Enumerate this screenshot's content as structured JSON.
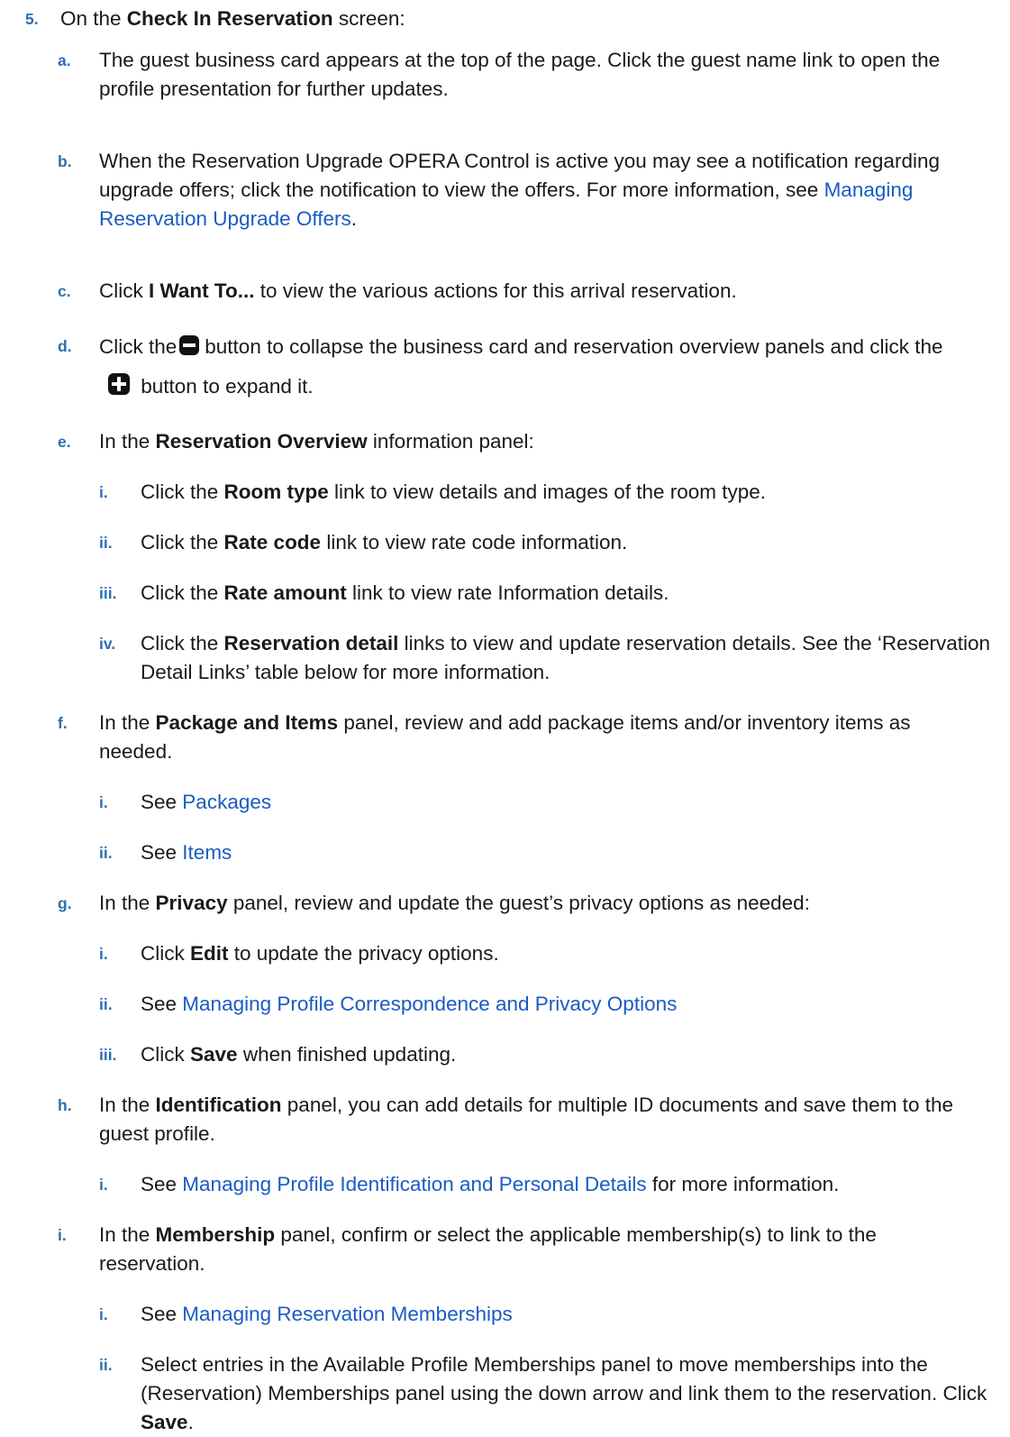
{
  "step5": {
    "num": "5.",
    "pre": "On the ",
    "bold": "Check In Reservation",
    "post": " screen:"
  },
  "a": {
    "num": "a.",
    "text": "The guest business card appears at the top of the page. Click the guest name link to open the profile presentation for further updates."
  },
  "b": {
    "num": "b.",
    "text": "When the Reservation Upgrade OPERA Control is active you may see a notification regarding upgrade offers; click the notification to view the offers. For more information, see ",
    "link": "Managing Reservation Upgrade Offers",
    "post": "."
  },
  "c": {
    "num": "c.",
    "pre": "Click ",
    "bold": "I Want To...",
    "post": " to view the various actions for this arrival reservation."
  },
  "d": {
    "num": "d.",
    "pre": "Click the",
    "mid": "button to collapse the business card and reservation overview panels and click the",
    "post": "button to expand it.",
    "collapse_icon": "collapse-minus-icon",
    "expand_icon": "expand-plus-icon"
  },
  "e": {
    "num": "e.",
    "pre": "In the ",
    "bold": "Reservation Overview",
    "post": " information panel:"
  },
  "e_i": {
    "num": "i.",
    "pre": "Click the ",
    "bold": "Room type",
    "post": " link to view details and images of the room type."
  },
  "e_ii": {
    "num": "ii.",
    "pre": "Click the ",
    "bold": "Rate code",
    "post": " link to view rate code information."
  },
  "e_iii": {
    "num": "iii.",
    "pre": "Click the ",
    "bold": "Rate amount",
    "post": " link to view rate Information details."
  },
  "e_iv": {
    "num": "iv.",
    "pre": "Click the ",
    "bold": "Reservation detail",
    "post": " links to view and update reservation details. See the ‘Reservation Detail Links’ table below for more information."
  },
  "f": {
    "num": "f.",
    "pre": "In the ",
    "bold": "Package and Items",
    "post": " panel, review and add package items and/or inventory items as needed."
  },
  "f_i": {
    "num": "i.",
    "pre": "See ",
    "link": "Packages"
  },
  "f_ii": {
    "num": "ii.",
    "pre": "See ",
    "link": "Items"
  },
  "g": {
    "num": "g.",
    "pre": "In the ",
    "bold": "Privacy",
    "post": " panel, review and update the guest’s privacy options as needed:"
  },
  "g_i": {
    "num": "i.",
    "pre": "Click ",
    "bold": "Edit",
    "post": " to update the privacy options."
  },
  "g_ii": {
    "num": "ii.",
    "pre": "See ",
    "link": "Managing Profile Correspondence and Privacy Options"
  },
  "g_iii": {
    "num": "iii.",
    "pre": "Click ",
    "bold": "Save",
    "post": " when finished updating."
  },
  "h": {
    "num": "h.",
    "pre": "In the ",
    "bold": "Identification",
    "post": " panel, you can add details for multiple ID documents and save them to the guest profile."
  },
  "h_i": {
    "num": "i.",
    "pre": "See ",
    "link": "Managing Profile Identification and Personal Details",
    "post": " for more information."
  },
  "i": {
    "num": "i.",
    "pre": "In the ",
    "bold": "Membership",
    "post": " panel, confirm or select the applicable membership(s) to link to the reservation."
  },
  "i_i": {
    "num": "i.",
    "pre": "See ",
    "link": "Managing Reservation Memberships"
  },
  "i_ii": {
    "num": "ii.",
    "pre": "Select entries in the Available Profile Memberships panel to move memberships into the (Reservation) Memberships panel using the down arrow and link them to the reservation. Click ",
    "bold": "Save",
    "post": "."
  }
}
